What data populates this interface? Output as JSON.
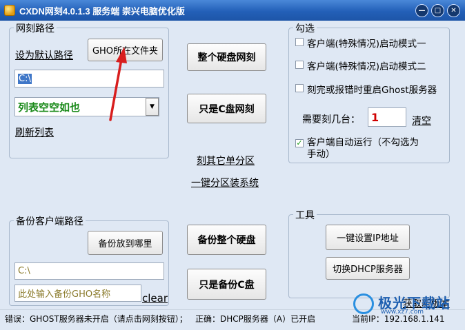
{
  "window": {
    "title": "CXDN网刻4.0.1.3 服务端 崇兴电脑优化版"
  },
  "path_group": {
    "legend": "网刻路径",
    "set_default_link": "设为默认路径",
    "gho_folder_button": "GHO所在文件夹",
    "path_value": "C:\\",
    "list_value": "列表空空如也",
    "refresh_link": "刷新列表"
  },
  "center_top": {
    "whole_disk_button": "整个硬盘网刻",
    "c_only_button": "只是C盘网刻",
    "other_partition_link": "刻其它单分区",
    "one_key_partition_link": "一键分区装系统"
  },
  "options_group": {
    "legend": "勾选",
    "client_mode1": "客户端(特殊情况)启动模式一",
    "client_mode2": "客户端(特殊情况)启动模式二",
    "restart_ghost": "刻完或报错时重启Ghost服务器",
    "how_many_label": "需要刻几台：",
    "how_many_value": "1",
    "clear_link": "清空",
    "auto_run_line1": "客户端自动运行（不勾选为",
    "auto_run_line2": "手动）",
    "auto_run_checked": true
  },
  "backup_group": {
    "legend": "备份客户端路径",
    "where_button": "备份放到哪里",
    "path_value": "C:\\",
    "gho_name_placeholder": "此处输入备份GHO名称",
    "clear_link": "clear"
  },
  "center_bottom": {
    "backup_disk_button": "备份整个硬盘",
    "backup_c_button": "只是备份C盘"
  },
  "tools_group": {
    "legend": "工具",
    "set_ip_button": "一键设置IP地址",
    "dhcp_button": "切换DHCP服务器"
  },
  "status": {
    "error_text": "错误：GHOST服务器未开启（请点击网刻按钮）；",
    "ok_text": "正确：DHCP服务器（A）已开启",
    "get_new_version": "获取新版本",
    "current_ip": "当前IP：192.168.1.141"
  },
  "watermark": {
    "text": "极光下载站",
    "sub": "www.xz7.com"
  },
  "colors": {
    "titlebar": "#2360b8",
    "list_text": "#1a8a1a",
    "count_text": "#d00000",
    "arrow": "#d81e1e"
  }
}
